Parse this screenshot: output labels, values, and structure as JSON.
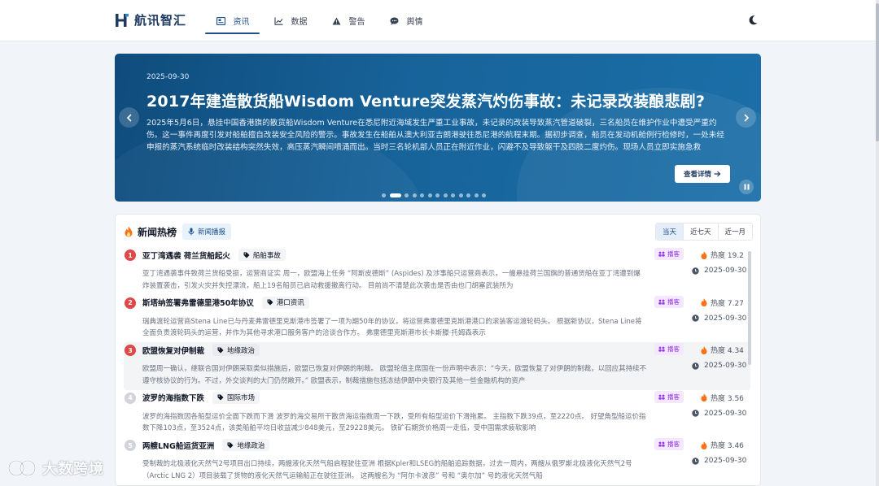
{
  "header": {
    "app_name": "航讯智汇",
    "nav": [
      {
        "label": "资讯",
        "icon": "newspaper-icon",
        "active": true
      },
      {
        "label": "数据",
        "icon": "chart-line-icon",
        "active": false
      },
      {
        "label": "警告",
        "icon": "warning-icon",
        "active": false
      },
      {
        "label": "舆情",
        "icon": "comment-icon",
        "active": false
      }
    ],
    "theme_toggle_icon": "moon-icon"
  },
  "hero": {
    "date": "2025-09-30",
    "title": "2017年建造散货船Wisdom Venture突发蒸汽灼伤事故：未记录改装酿悲剧?",
    "body": "2025年5月6日，悬挂中国香港旗的散货船Wisdom Venture在悉尼附近海域发生严重工业事故，未记录的改装导致蒸汽管道破裂，三名船员在维护作业中遭受严重灼伤。这一事件再度引发对船舶擅自改装安全风险的警示。事故发生在船舶从澳大利亚吉朗港驶往悉尼港的航程末期。据初步调查，船员在发动机舱例行检修时，一处未经申报的蒸汽系统临时改装结构突然失效，高压蒸汽瞬间喷涌而出。当时三名轮机部人员正在附近作业，闪避不及导致躯干及四肢二度灼伤。现场人员立即实施急救",
    "button_label": "查看详情",
    "slide_count": 13,
    "active_slide": 1
  },
  "hot": {
    "title": "新闻热榜",
    "broadcast_label": "新闻播报",
    "periods": [
      {
        "label": "当天",
        "active": true
      },
      {
        "label": "近七天",
        "active": false
      },
      {
        "label": "近一月",
        "active": false
      }
    ],
    "podcast_label": "播客",
    "heat_prefix": "热度",
    "items": [
      {
        "rank": "1",
        "title": "亚丁湾遇袭 荷兰货船起火",
        "tag": "船舶事故",
        "body": "亚丁湾遇袭事件致荷兰货船受损，运营商证实 周一，欧盟海上任务 “阿斯皮德斯” (Aspides) 及涉事船只运营商表示，一艘悬挂荷兰国旗的普通货船在亚丁湾遭到爆炸装置袭击，引发火灾并失控漂流，船上19名船员已启动救援撤离行动。 目前尚不清楚此次袭击是否由也门胡塞武装所为",
        "heat": "热度 19.2",
        "date": "2025-09-30"
      },
      {
        "rank": "2",
        "title": "斯塔纳签署弗雷德里港50年协议",
        "tag": "港口资讯",
        "body": "瑞典渡轮运营商Stena Line已与丹麦弗雷德里克斯港市签署了一项为期50年的协议，将运营弗雷德里克斯港港口的滚装客运渡轮码头。 根据新协议，Stena Line将全面负责渡轮码头的运营，并作为其他寻求港口服务客户的洽谈合作方。 弗雷德里克斯港市长卡斯滕·托姆森表示",
        "heat": "热度 7.27",
        "date": "2025-09-30"
      },
      {
        "rank": "3",
        "title": "欧盟恢复对伊制裁",
        "tag": "地缘政治",
        "body": "欧盟周一确认，继联合国对伊朗采取类似措施后，欧盟已恢复对伊朗的制裁。 欧盟轮值主席国在一份声明中表示：“今天，欧盟恢复了对伊朗的制裁，以回应其持续不遵守核协议的行为。不过，外交谈判的大门仍然敞开。” 欧盟表示，制裁措施包括冻结伊朗中央银行及其他一些金融机构的资产",
        "heat": "热度 4.34",
        "date": "2025-09-30"
      },
      {
        "rank": "4",
        "title": "波罗的海指数下跌",
        "tag": "国际市场",
        "body": "波罗的海指数因各船型运价全面下跌而下滑 波罗的海交易所干散货海运指数周一下跌，受所有船型运价下滑拖累。 主指数下跌39点，至2220点。 好望角型船运价指数下降103点，至3524点，该类船舶平均日收益减少848美元，至29228美元。 铁矿石期货价格周一走低，受中国需求疲软影响",
        "heat": "热度 3.56",
        "date": "2025-09-30"
      },
      {
        "rank": "5",
        "title": "两艘LNG船运货亚洲",
        "tag": "地缘政治",
        "body": "受制裁的北极液化天然气2号项目出口持续，两艘液化天然气船启程驶往亚洲 根据Kpler和LSEG的船舶追踪数据，过去一周内，两艘从俄罗斯北极液化天然气2号（Arctic LNG 2）项目装载了货物的液化天然气运输船正在驶往亚洲。 这两艘名为 “阿尔卡波彦” 号和 “奥尔加” 号的液化天然气船",
        "heat": "热度 3.46",
        "date": "2025-09-30"
      }
    ]
  },
  "watermark": {
    "text": "大数跨境"
  },
  "colors": {
    "brand": "#1d4f8c",
    "rank_top": "#e04747",
    "podcast": "#9333ea",
    "heat": "#f97316"
  }
}
